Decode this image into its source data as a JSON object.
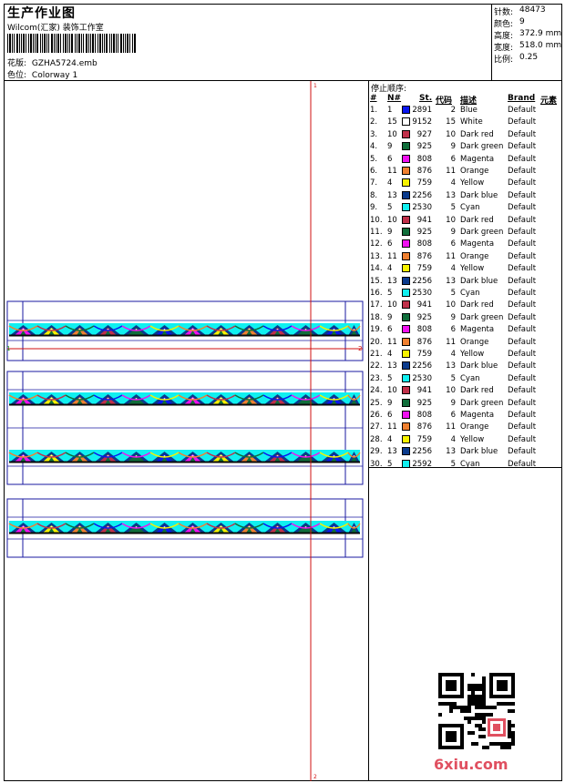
{
  "header": {
    "title": "生产作业图",
    "subtitle": "Wilcom(汇家) 装饰工作室",
    "design_label": "花版:",
    "design_value": "GZHA5724.emb",
    "colorway_label": "色位:",
    "colorway_value": "Colorway 1"
  },
  "stats": [
    {
      "label": "针数:",
      "value": "48473"
    },
    {
      "label": "颜色:",
      "value": "9"
    },
    {
      "label": "高度:",
      "value": "372.9 mm"
    },
    {
      "label": "宽度:",
      "value": "518.0 mm"
    },
    {
      "label": "比例:",
      "value": "0.25"
    }
  ],
  "stop_sequence": {
    "title": "停止顺序:",
    "headers": {
      "index": "#",
      "no": "N#",
      "st": "St.",
      "code": "代码",
      "desc": "描述",
      "brand": "Brand",
      "element": "元素"
    },
    "rows": [
      {
        "i": "1.",
        "n": "1",
        "color": "#0a16f0",
        "st": "2891",
        "code": "2",
        "desc": "Blue",
        "brand": "Default"
      },
      {
        "i": "2.",
        "n": "15",
        "color": "#ffffff",
        "st": "9152",
        "code": "15",
        "desc": "White",
        "brand": "Default"
      },
      {
        "i": "3.",
        "n": "10",
        "color": "#c0304a",
        "st": "927",
        "code": "10",
        "desc": "Dark red",
        "brand": "Default"
      },
      {
        "i": "4.",
        "n": "9",
        "color": "#0f6e3a",
        "st": "925",
        "code": "9",
        "desc": "Dark green",
        "brand": "Default"
      },
      {
        "i": "5.",
        "n": "6",
        "color": "#f010f0",
        "st": "808",
        "code": "6",
        "desc": "Magenta",
        "brand": "Default"
      },
      {
        "i": "6.",
        "n": "11",
        "color": "#f08030",
        "st": "876",
        "code": "11",
        "desc": "Orange",
        "brand": "Default"
      },
      {
        "i": "7.",
        "n": "4",
        "color": "#f6f200",
        "st": "759",
        "code": "4",
        "desc": "Yellow",
        "brand": "Default"
      },
      {
        "i": "8.",
        "n": "13",
        "color": "#0a3a8c",
        "st": "2256",
        "code": "13",
        "desc": "Dark blue",
        "brand": "Default"
      },
      {
        "i": "9.",
        "n": "5",
        "color": "#10f0f0",
        "st": "2530",
        "code": "5",
        "desc": "Cyan",
        "brand": "Default"
      },
      {
        "i": "10.",
        "n": "10",
        "color": "#c0304a",
        "st": "941",
        "code": "10",
        "desc": "Dark red",
        "brand": "Default"
      },
      {
        "i": "11.",
        "n": "9",
        "color": "#0f6e3a",
        "st": "925",
        "code": "9",
        "desc": "Dark green",
        "brand": "Default"
      },
      {
        "i": "12.",
        "n": "6",
        "color": "#f010f0",
        "st": "808",
        "code": "6",
        "desc": "Magenta",
        "brand": "Default"
      },
      {
        "i": "13.",
        "n": "11",
        "color": "#f08030",
        "st": "876",
        "code": "11",
        "desc": "Orange",
        "brand": "Default"
      },
      {
        "i": "14.",
        "n": "4",
        "color": "#f6f200",
        "st": "759",
        "code": "4",
        "desc": "Yellow",
        "brand": "Default"
      },
      {
        "i": "15.",
        "n": "13",
        "color": "#0a3a8c",
        "st": "2256",
        "code": "13",
        "desc": "Dark blue",
        "brand": "Default"
      },
      {
        "i": "16.",
        "n": "5",
        "color": "#10f0f0",
        "st": "2530",
        "code": "5",
        "desc": "Cyan",
        "brand": "Default"
      },
      {
        "i": "17.",
        "n": "10",
        "color": "#c0304a",
        "st": "941",
        "code": "10",
        "desc": "Dark red",
        "brand": "Default"
      },
      {
        "i": "18.",
        "n": "9",
        "color": "#0f6e3a",
        "st": "925",
        "code": "9",
        "desc": "Dark green",
        "brand": "Default"
      },
      {
        "i": "19.",
        "n": "6",
        "color": "#f010f0",
        "st": "808",
        "code": "6",
        "desc": "Magenta",
        "brand": "Default"
      },
      {
        "i": "20.",
        "n": "11",
        "color": "#f08030",
        "st": "876",
        "code": "11",
        "desc": "Orange",
        "brand": "Default"
      },
      {
        "i": "21.",
        "n": "4",
        "color": "#f6f200",
        "st": "759",
        "code": "4",
        "desc": "Yellow",
        "brand": "Default"
      },
      {
        "i": "22.",
        "n": "13",
        "color": "#0a3a8c",
        "st": "2256",
        "code": "13",
        "desc": "Dark blue",
        "brand": "Default"
      },
      {
        "i": "23.",
        "n": "5",
        "color": "#10f0f0",
        "st": "2530",
        "code": "5",
        "desc": "Cyan",
        "brand": "Default"
      },
      {
        "i": "24.",
        "n": "10",
        "color": "#c0304a",
        "st": "941",
        "code": "10",
        "desc": "Dark red",
        "brand": "Default"
      },
      {
        "i": "25.",
        "n": "9",
        "color": "#0f6e3a",
        "st": "925",
        "code": "9",
        "desc": "Dark green",
        "brand": "Default"
      },
      {
        "i": "26.",
        "n": "6",
        "color": "#f010f0",
        "st": "808",
        "code": "6",
        "desc": "Magenta",
        "brand": "Default"
      },
      {
        "i": "27.",
        "n": "11",
        "color": "#f08030",
        "st": "876",
        "code": "11",
        "desc": "Orange",
        "brand": "Default"
      },
      {
        "i": "28.",
        "n": "4",
        "color": "#f6f200",
        "st": "759",
        "code": "4",
        "desc": "Yellow",
        "brand": "Default"
      },
      {
        "i": "29.",
        "n": "13",
        "color": "#0a3a8c",
        "st": "2256",
        "code": "13",
        "desc": "Dark blue",
        "brand": "Default"
      },
      {
        "i": "30.",
        "n": "5",
        "color": "#10f0f0",
        "st": "2592",
        "code": "5",
        "desc": "Cyan",
        "brand": "Default"
      }
    ]
  },
  "design_preview": {
    "marker_top": "1",
    "marker_bottom": "2",
    "marker_left": "1",
    "marker_right": "2",
    "frame_color": "#1a1aa0",
    "guide_color": "#d01010",
    "band_colors": [
      "#10f0f0",
      "#0a3a8c",
      "#0f6e3a",
      "#f010f0",
      "#f6f200",
      "#f08030",
      "#c0304a",
      "#0a16f0"
    ]
  },
  "watermark": {
    "logo_text": "6xiu.com",
    "qr_icon": "qr-code-icon"
  }
}
